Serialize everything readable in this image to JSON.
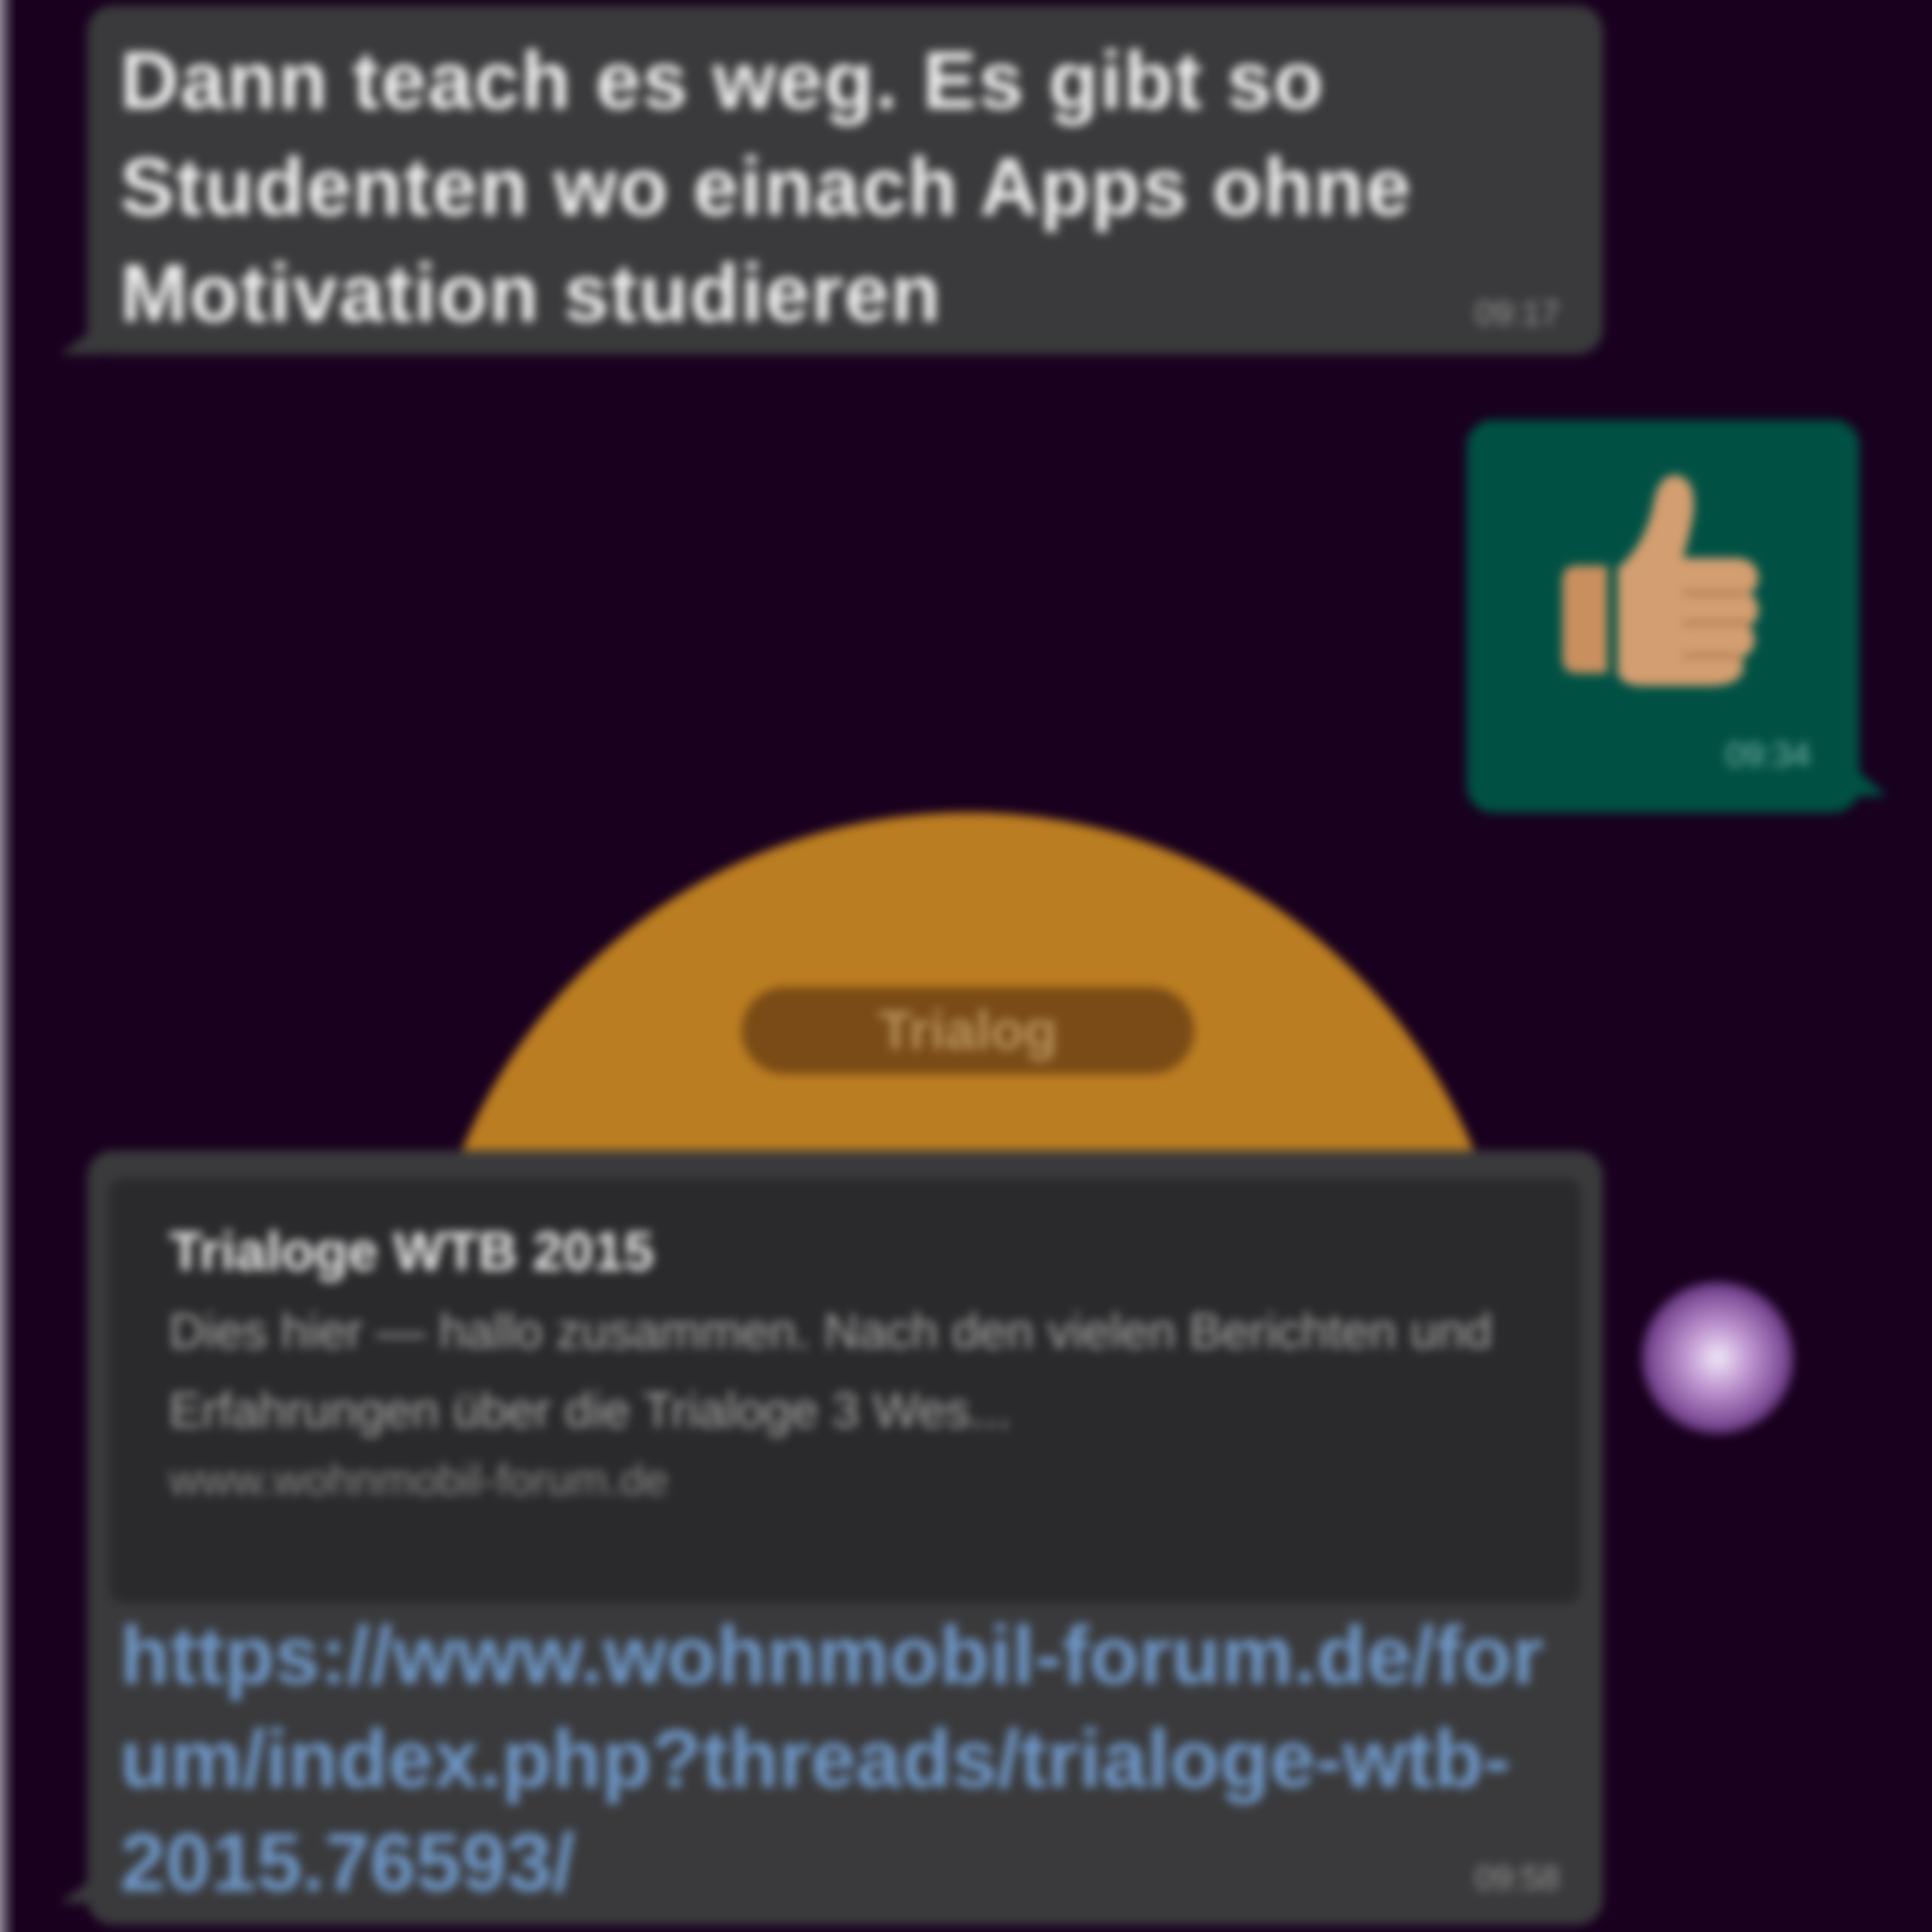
{
  "messages": [
    {
      "text": "Dann teach es weg. Es gibt so Studenten wo einach Apps ohne Motivation studieren",
      "time": "09:17"
    },
    {
      "emoji": "👍🏽",
      "time": "09:34"
    },
    {
      "preview_tag": "Trialog",
      "preview_title": "Trialoge WTB 2015",
      "preview_description": "Dies hier — hallo zusammen. Nach den vielen Berichten und Erfahrungen über die Trialoge 3 Wes...",
      "preview_domain": "www.wohnmobil-forum.de",
      "link": "https://www.wohnmobil-forum.de/forum/index.php?threads/trialoge-wtb-2015.76593/",
      "time": "09:58"
    }
  ],
  "colors": {
    "background": "#19001f",
    "incoming_bubble": "#3a3a3c",
    "outgoing_bubble": "#005144",
    "link": "#6f98c8"
  },
  "icons": {
    "scroll_button": "avatar-bubble-icon"
  }
}
